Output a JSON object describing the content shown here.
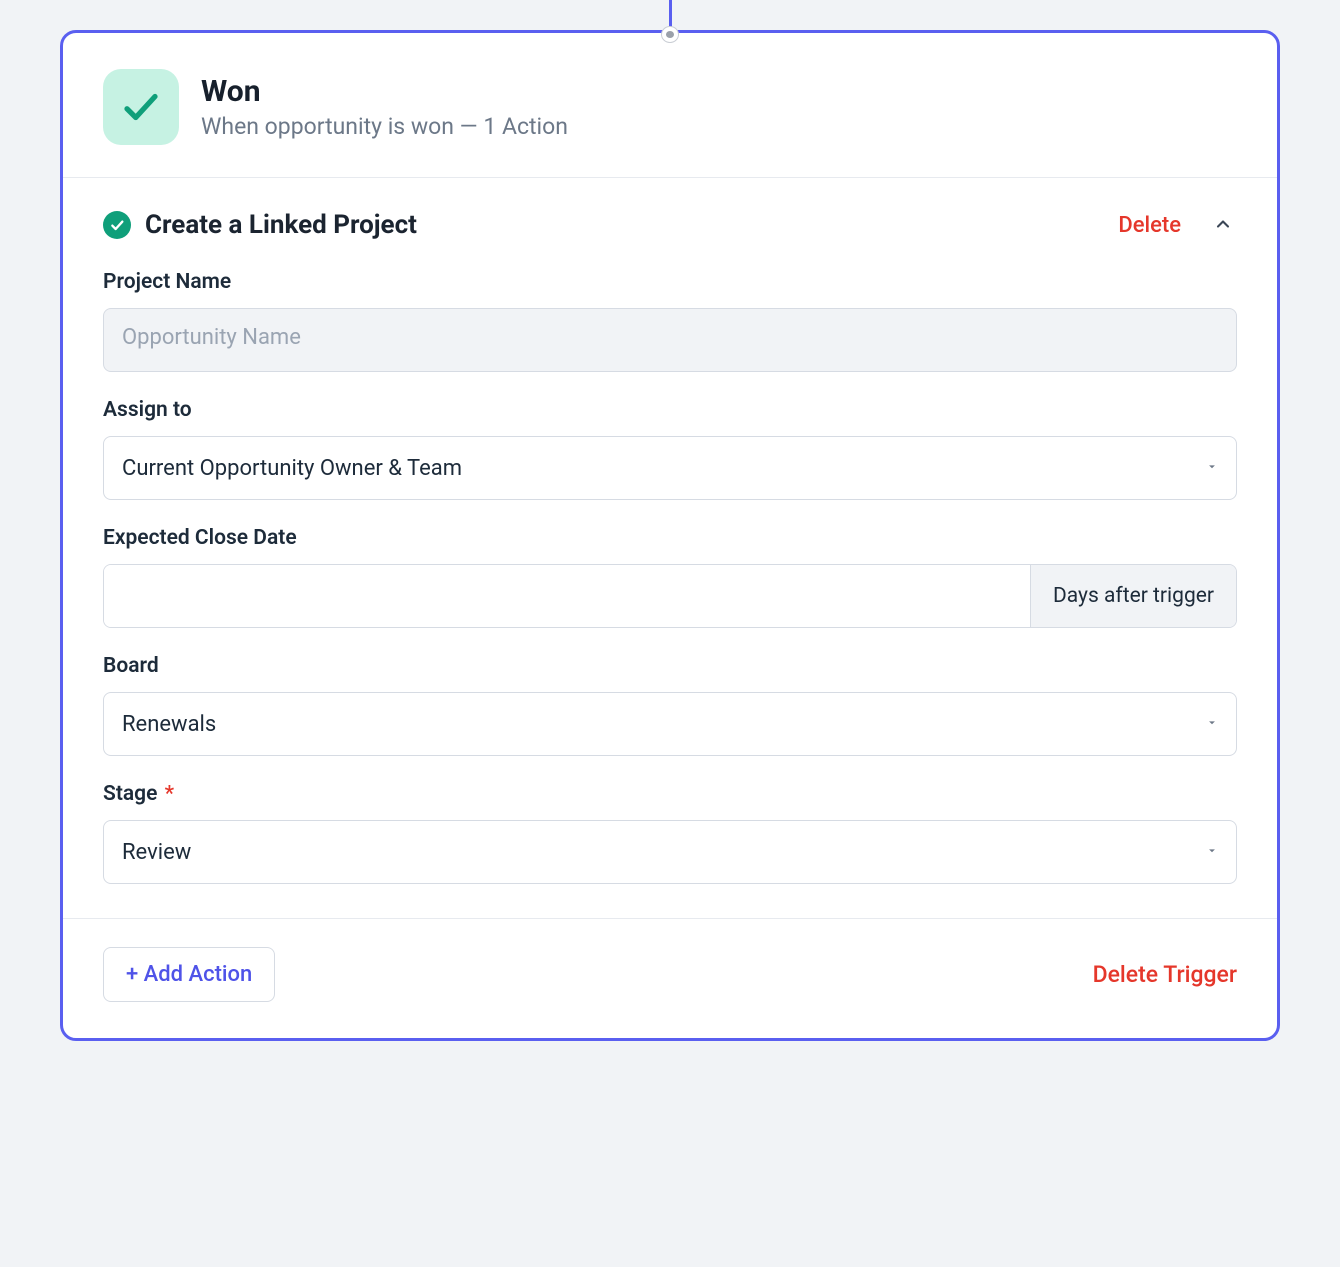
{
  "header": {
    "title": "Won",
    "subtitle": "When opportunity is won — 1 Action"
  },
  "action": {
    "title": "Create a Linked Project",
    "delete_label": "Delete"
  },
  "form": {
    "project_name": {
      "label": "Project Name",
      "value": "Opportunity Name"
    },
    "assign_to": {
      "label": "Assign to",
      "value": "Current Opportunity Owner & Team"
    },
    "close_date": {
      "label": "Expected Close Date",
      "value": "",
      "addon": "Days after trigger"
    },
    "board": {
      "label": "Board",
      "value": "Renewals"
    },
    "stage": {
      "label": "Stage",
      "value": "Review"
    }
  },
  "footer": {
    "add_action": "+ Add Action",
    "delete_trigger": "Delete Trigger"
  }
}
